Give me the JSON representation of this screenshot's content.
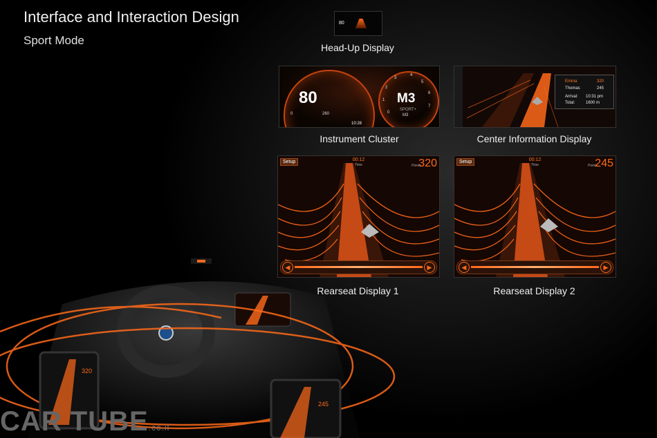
{
  "header": {
    "title": "Interface and Interaction Design",
    "subtitle": "Sport Mode"
  },
  "panels": {
    "hud": {
      "caption": "Head-Up Display",
      "speed": "80"
    },
    "cluster": {
      "caption": "Instrument Cluster",
      "speed": "80",
      "gear": "M3",
      "left_min": "0",
      "left_max": "260",
      "right_ticks": [
        "0",
        "1",
        "2",
        "3",
        "4",
        "5",
        "6",
        "7"
      ],
      "sport_label": "SPORT+",
      "gear_small": "M3",
      "clock": "10:28"
    },
    "cid": {
      "caption": "Center Information Display",
      "player1": "Emma",
      "player1_score": "320",
      "player2": "Thomas",
      "player2_score": "245",
      "arrival_label": "Arrival:",
      "arrival_time": "10:31 pm",
      "total_label": "Total:",
      "total_value": "1600 m"
    },
    "rearseat1": {
      "caption": "Rearseat Display 1",
      "setup_label": "Setup",
      "time": "00:12",
      "time_label": "Time",
      "points_label": "Points",
      "points": "320"
    },
    "rearseat2": {
      "caption": "Rearseat Display 2",
      "setup_label": "Setup",
      "time": "00:12",
      "time_label": "Time",
      "points_label": "Points",
      "points": "245"
    }
  },
  "interior_screens": {
    "left_score": "320",
    "right_score": "245"
  },
  "watermark": {
    "brand": "CAR TUBE",
    "domain": ".co.il"
  },
  "colors": {
    "accent": "#ff6a1a",
    "background": "#000000"
  }
}
